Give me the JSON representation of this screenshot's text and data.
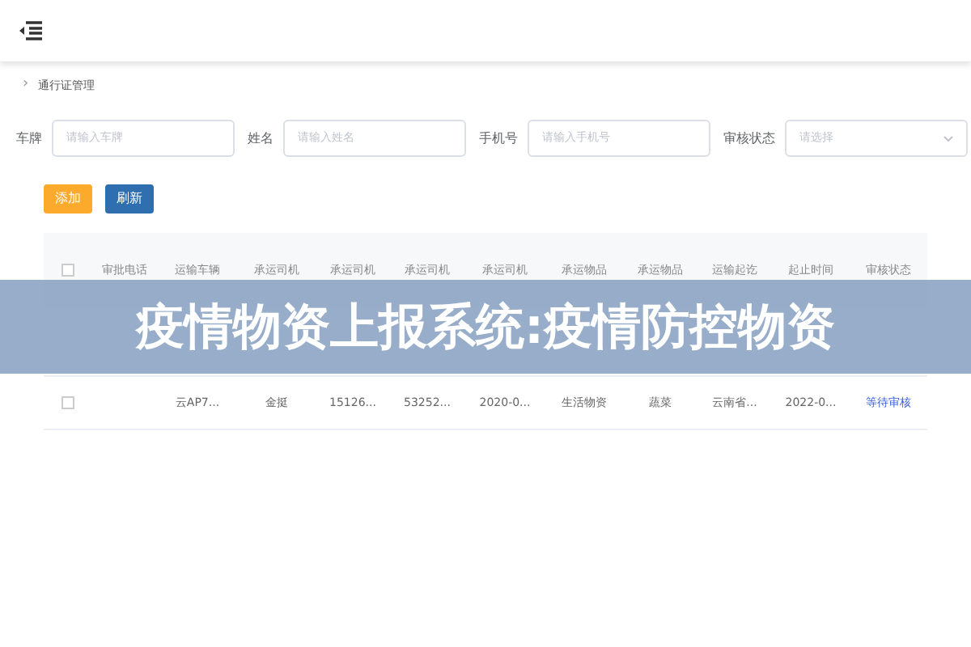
{
  "breadcrumb_icon": "›",
  "breadcrumb": "通行证管理",
  "filters": [
    {
      "label": "车牌",
      "placeholder": "请输入车牌",
      "kind": "input"
    },
    {
      "label": "姓名",
      "placeholder": "请输入姓名",
      "kind": "input"
    },
    {
      "label": "手机号",
      "placeholder": "请输入手机号",
      "kind": "input"
    },
    {
      "label": "审核状态",
      "placeholder": "请选择",
      "kind": "select"
    }
  ],
  "buttons": [
    {
      "label": "添加",
      "kind": "add"
    },
    {
      "label": "刷新",
      "kind": "refresh"
    }
  ],
  "table": {
    "columns": [
      "审批电话",
      "运输车辆",
      "承运司机",
      "承运司机",
      "承运司机",
      "承运司机",
      "承运物品",
      "承运物品",
      "运输起讫",
      "起止时间",
      "审核状态"
    ],
    "all_checked": false,
    "rows": [
      {
        "checked": false,
        "cells": [
          "",
          "云AP7...",
          "金挺",
          "15126...",
          "53252...",
          "2020-0...",
          "生活物资",
          "蔬菜",
          "云南省...",
          "2022-0...",
          "等待审核"
        ]
      }
    ]
  },
  "banner": "疫情物资上报系统:疫情防控物资"
}
